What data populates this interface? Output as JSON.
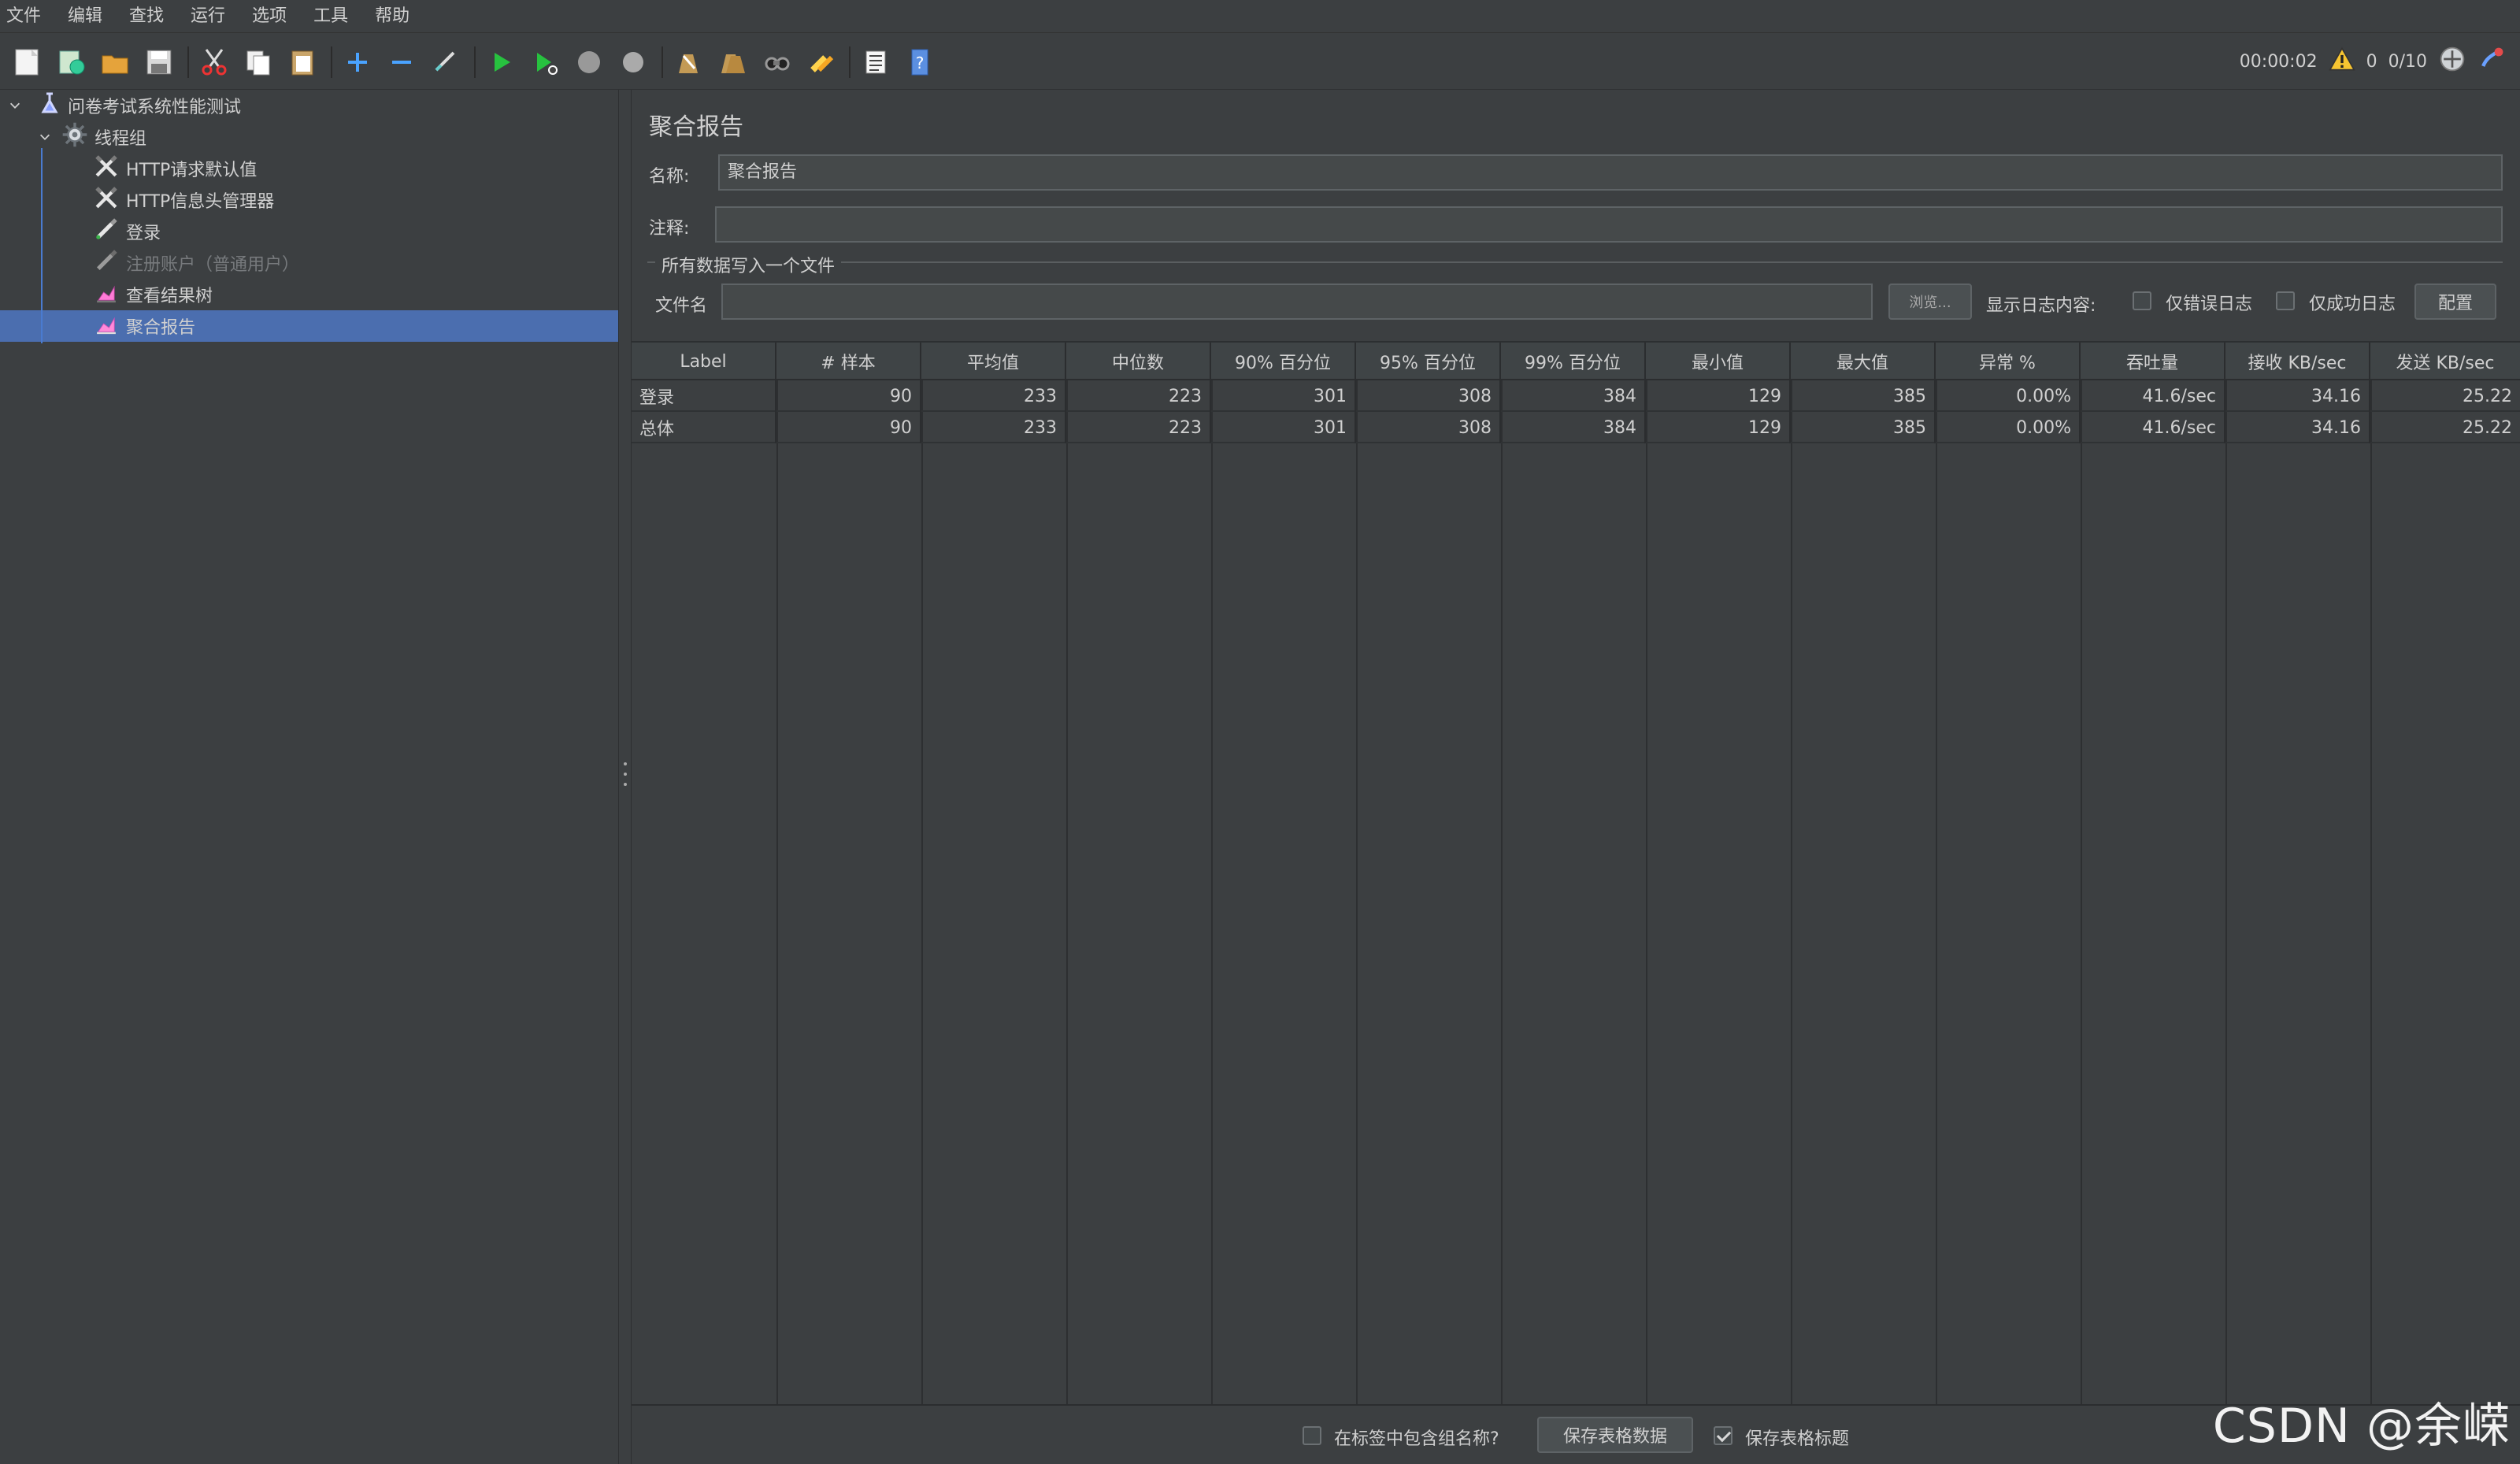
{
  "menu": [
    "文件",
    "编辑",
    "查找",
    "运行",
    "选项",
    "工具",
    "帮助"
  ],
  "toolbar": {
    "timer": "00:00:02",
    "warning_count": "0",
    "threads": "0/10"
  },
  "tree": {
    "items": [
      {
        "label": "问卷考试系统性能测试",
        "level": 0,
        "icon": "test-plan-icon",
        "expanded": true
      },
      {
        "label": "线程组",
        "level": 1,
        "icon": "gear-icon",
        "expanded": true
      },
      {
        "label": "HTTP请求默认值",
        "level": 2,
        "icon": "wrench-icon"
      },
      {
        "label": "HTTP信息头管理器",
        "level": 2,
        "icon": "wrench-icon"
      },
      {
        "label": "登录",
        "level": 2,
        "icon": "pipette-icon"
      },
      {
        "label": "注册账户（普通用户）",
        "level": 2,
        "icon": "pipette-icon",
        "disabled": true
      },
      {
        "label": "查看结果树",
        "level": 2,
        "icon": "chart-icon"
      },
      {
        "label": "聚合报告",
        "level": 2,
        "icon": "chart-icon",
        "selected": true
      }
    ]
  },
  "panel": {
    "title": "聚合报告",
    "name_label": "名称:",
    "name_value": "聚合报告",
    "comment_label": "注释:",
    "comment_value": "",
    "file_group_title": "所有数据写入一个文件",
    "filename_label": "文件名",
    "filename_value": "",
    "browse_label": "浏览...",
    "log_content_label": "显示日志内容:",
    "errors_only_label": "仅错误日志",
    "success_only_label": "仅成功日志",
    "config_label": "配置"
  },
  "table": {
    "headers": [
      "Label",
      "# 样本",
      "平均值",
      "中位数",
      "90% 百分位",
      "95% 百分位",
      "99% 百分位",
      "最小值",
      "最大值",
      "异常 %",
      "吞吐量",
      "接收 KB/sec",
      "发送 KB/sec"
    ],
    "rows": [
      [
        "登录",
        "90",
        "233",
        "223",
        "301",
        "308",
        "384",
        "129",
        "385",
        "0.00%",
        "41.6/sec",
        "34.16",
        "25.22"
      ],
      [
        "总体",
        "90",
        "233",
        "223",
        "301",
        "308",
        "384",
        "129",
        "385",
        "0.00%",
        "41.6/sec",
        "34.16",
        "25.22"
      ]
    ]
  },
  "bottom": {
    "include_group_label": "在标签中包含组名称?",
    "save_table_label": "保存表格数据",
    "save_header_label": "保存表格标题"
  },
  "watermark": "CSDN @余嵘"
}
